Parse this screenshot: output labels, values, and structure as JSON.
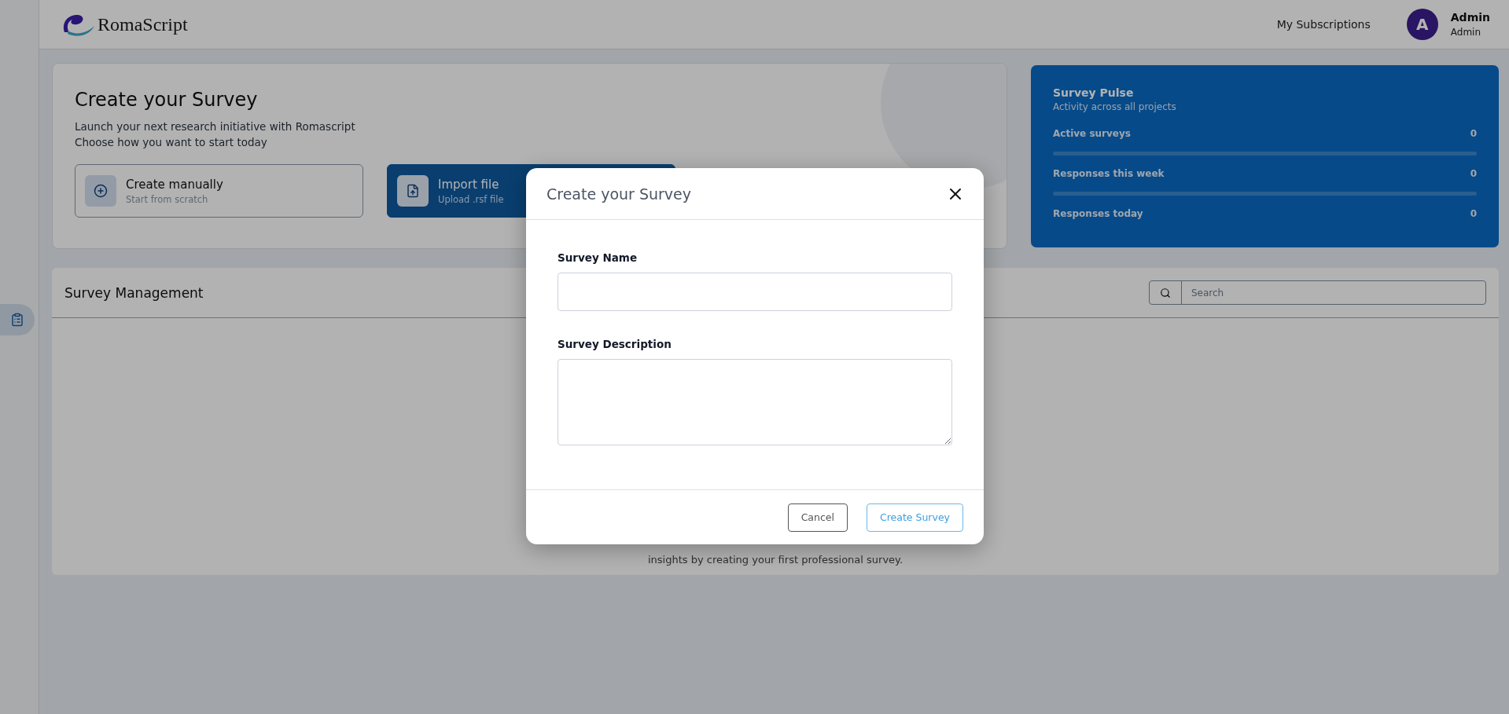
{
  "header": {
    "logo_text": "RomaScript",
    "nav_link": "My Subscriptions",
    "user": {
      "initial": "A",
      "name": "Admin",
      "role": "Admin"
    }
  },
  "sidebar": {
    "items": [
      {
        "selected": true
      }
    ]
  },
  "hero": {
    "title": "Create your Survey",
    "lines": [
      "Launch your next research initiative with Romascript",
      "Choose how you want to start today"
    ],
    "options": [
      {
        "kind": "outline",
        "title": "Create manually",
        "subtitle": "Start from scratch"
      },
      {
        "kind": "primary",
        "title": "Import file",
        "subtitle": "Upload .rsf file"
      }
    ]
  },
  "pulse": {
    "title": "Survey Pulse",
    "subtitle": "Activity across all projects",
    "metrics": [
      {
        "label": "Active surveys",
        "value": "0"
      },
      {
        "label": "Responses this week",
        "value": "0"
      },
      {
        "label": "Responses today",
        "value": "0"
      }
    ]
  },
  "management": {
    "title": "Survey Management",
    "search": {
      "placeholder": "Search"
    },
    "empty_text": "insights by creating your first professional survey."
  },
  "modal": {
    "title": "Create your Survey",
    "fields": [
      {
        "kind": "input",
        "label": "Survey Name"
      },
      {
        "kind": "textarea",
        "label": "Survey Description"
      }
    ],
    "buttons": [
      {
        "kind": "secondary",
        "label": "Cancel"
      },
      {
        "kind": "primary",
        "label": "Create Survey"
      }
    ]
  }
}
